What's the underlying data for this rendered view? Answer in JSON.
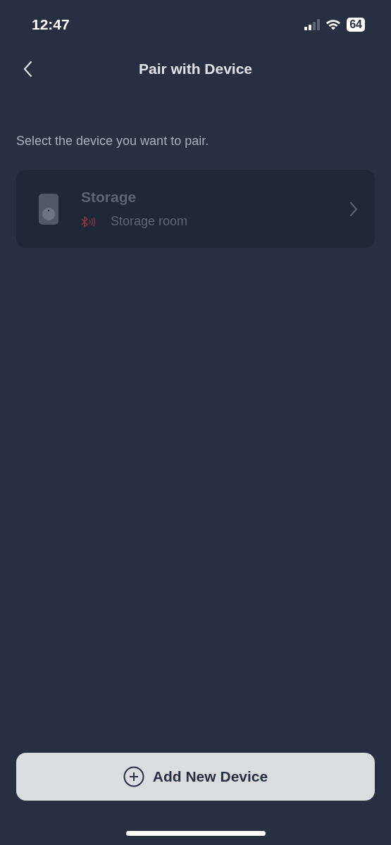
{
  "status_bar": {
    "time": "12:47",
    "battery": "64"
  },
  "nav": {
    "title": "Pair with Device"
  },
  "prompt": "Select the device you want to pair.",
  "devices": [
    {
      "name": "Storage",
      "location": "Storage room",
      "disabled": true
    }
  ],
  "add_button": {
    "label": "Add New Device"
  }
}
